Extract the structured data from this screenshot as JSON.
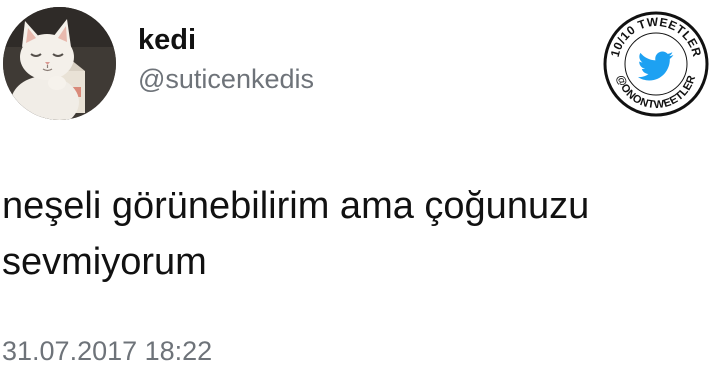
{
  "author": {
    "display_name": "kedi",
    "handle": "@suticenkedis",
    "avatar": "cat-avatar"
  },
  "badge": {
    "text_top": "10/10 TWEETLER",
    "text_bottom": "@ONONTWEETLER",
    "icon": "twitter-bird-icon",
    "colors": {
      "ring": "#111111",
      "bird": "#1da1f2"
    }
  },
  "tweet": {
    "text": "neşeli görünebilirim ama çoğunuzu\nsevmiyorum",
    "timestamp": "31.07.2017 18:22"
  }
}
